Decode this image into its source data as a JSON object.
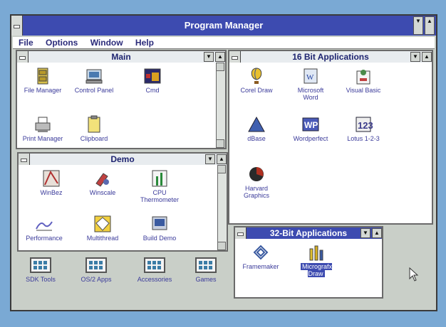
{
  "app": {
    "title": "Program Manager"
  },
  "menu": [
    "File",
    "Options",
    "Window",
    "Help"
  ],
  "windows": {
    "main": {
      "title": "Main",
      "icons": [
        "File Manager",
        "Control Panel",
        "Cmd",
        "Print Manager",
        "Clipboard"
      ]
    },
    "demo": {
      "title": "Demo",
      "icons": [
        "WinBez",
        "Winscale",
        "CPU Thermometer",
        "Performance",
        "Multithread",
        "Build Demo"
      ]
    },
    "sixteen": {
      "title": "16 Bit Applications",
      "icons": [
        "Corel Draw",
        "Microsoft Word",
        "Visual Basic",
        "dBase",
        "Wordperfect",
        "Lotus 1-2-3",
        "Harvard Graphics"
      ]
    },
    "thirtytwo": {
      "title": "32-Bit Applications",
      "icons": [
        "Framemaker",
        "Micrografx Draw"
      ]
    }
  },
  "groups": [
    "SDK Tools",
    "OS/2 Apps",
    "Accessories",
    "Games"
  ],
  "colors": {
    "active_title": "#3d4bb0",
    "inactive_title": "#e8ecef",
    "desktop": "#7aa9d4"
  }
}
